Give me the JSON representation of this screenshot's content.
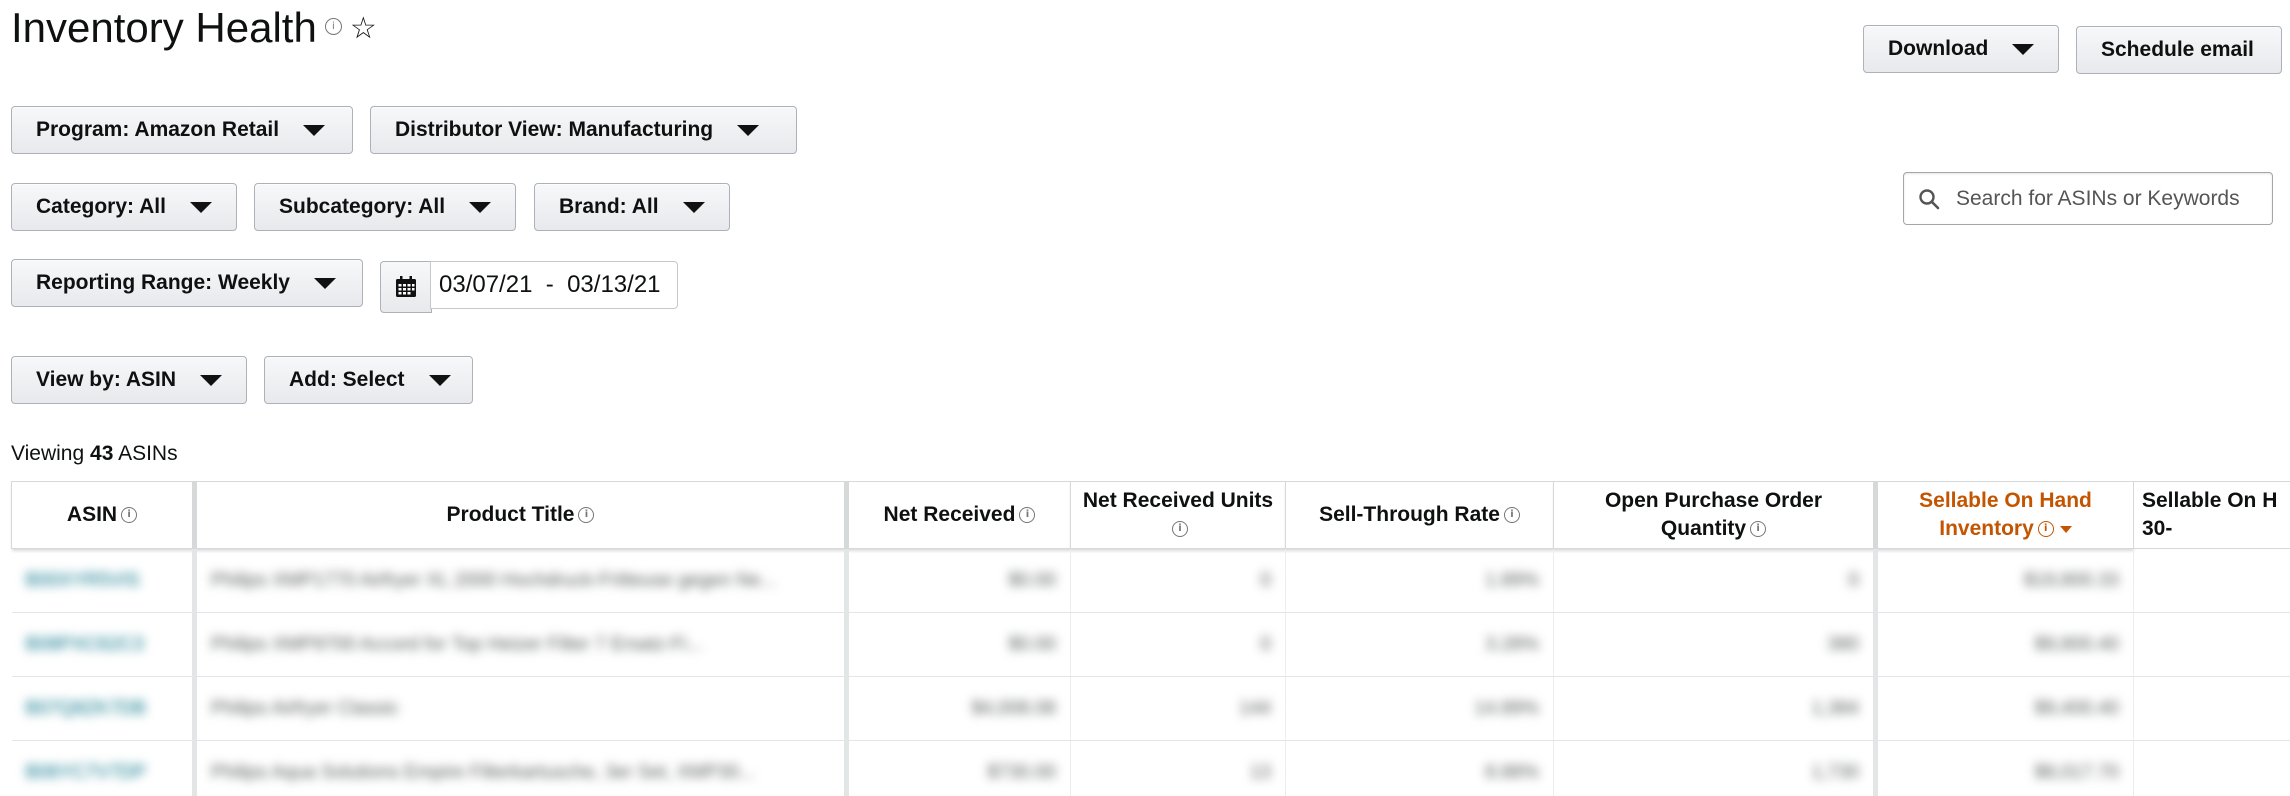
{
  "header": {
    "title": "Inventory Health",
    "info_icon": "info-icon",
    "star_icon": "star-outline-icon"
  },
  "actions": {
    "download_label": "Download",
    "schedule_label": "Schedule email"
  },
  "filters": {
    "program": "Program: Amazon Retail",
    "distributor": "Distributor View: Manufacturing",
    "category": "Category: All",
    "subcategory": "Subcategory: All",
    "brand": "Brand: All",
    "reporting_range": "Reporting Range: Weekly",
    "date_range": "03/07/21  -  03/13/21",
    "view_by": "View by: ASIN",
    "add": "Add: Select"
  },
  "search": {
    "placeholder": "Search for ASINs or Keywords"
  },
  "viewing": {
    "prefix": "Viewing",
    "count": "43",
    "suffix": "ASINs"
  },
  "table": {
    "columns": [
      "ASIN",
      "Product Title",
      "Net Received",
      "Net Received Units",
      "Sell-Through Rate",
      "Open Purchase Order Quantity",
      "Sellable On Hand Inventory",
      "Sellable On H 30-"
    ],
    "rows": [
      [
        "B00XYR5VIS",
        "Philips XMP1770 Airfryer XL 2000 Hochdruck-Fritteuse gegen Ne...",
        "$0.00",
        "0",
        "1.89%",
        "0",
        "$19,800.33",
        ""
      ],
      [
        "B08PXC62C3",
        "Philips XMP9700 Accord for Top Heizer Filter 7 Ersatz-Fi...",
        "$0.00",
        "0",
        "3.28%",
        "380",
        "$9,800.40",
        ""
      ],
      [
        "B07Q8ZK7DB",
        "Philips Airfryer Classic",
        "$4,008.08",
        "144",
        "14.89%",
        "1,384",
        "$9,400.40",
        ""
      ],
      [
        "B06YC7V7DP",
        "Philips Aqua Solutions Empire Filterkartusche, 3er Set, XMP30...",
        "$730.00",
        "13",
        "8.88%",
        "1,730",
        "$8,017.70",
        ""
      ]
    ]
  },
  "colors": {
    "sorted_header": "#c45500",
    "link": "#007185",
    "button_border": "#adb1b8"
  }
}
